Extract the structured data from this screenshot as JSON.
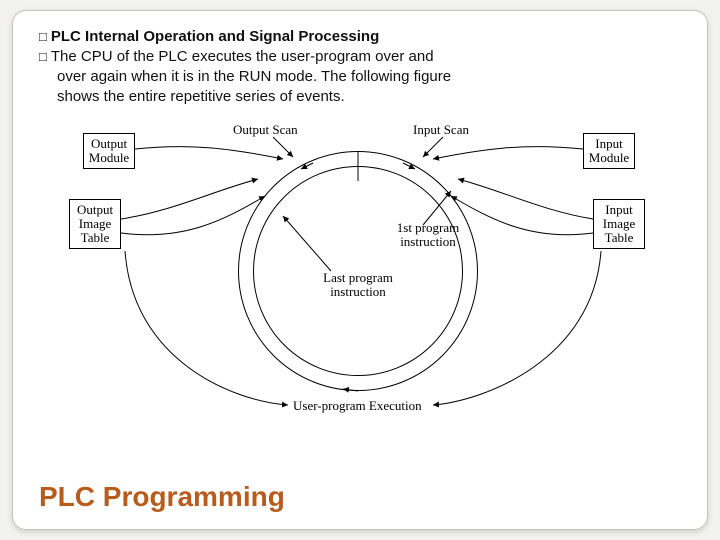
{
  "bullets": {
    "glyph": "□",
    "heading": "PLC Internal Operation and Signal Processing",
    "body_line1": "The CPU of the PLC executes the user-program over and",
    "body_line2": "over again when it is in the RUN mode. The following figure",
    "body_line3": "shows the entire repetitive series of events."
  },
  "figure": {
    "output_module": "Output\nModule",
    "output_image_table": "Output\nImage\nTable",
    "input_module": "Input\nModule",
    "input_image_table": "Input\nImage\nTable",
    "output_scan": "Output Scan",
    "input_scan": "Input Scan",
    "first_instr": "1st program\ninstruction",
    "last_instr": "Last program\ninstruction",
    "exec_label": "User-program Execution"
  },
  "title": "PLC Programming"
}
